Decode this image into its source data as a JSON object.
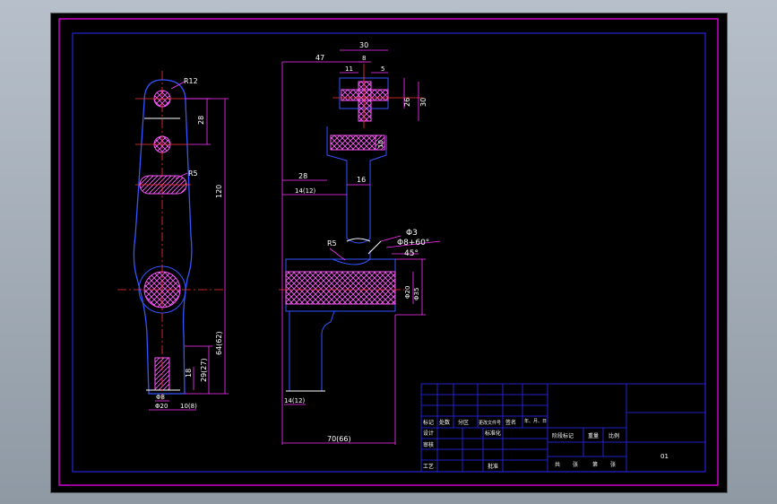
{
  "colors": {
    "background": "#000000",
    "outer_border": "#ff00ff",
    "inner_border": "#0000ff",
    "outline": "#3355ff",
    "dimension": "#ff33ff",
    "hatch": "#ff55ff",
    "center_line": "#ff3333",
    "text": "#ffffff"
  },
  "left_view": {
    "r12": "R12",
    "dim_28": "28",
    "r5": "R5",
    "dim_120": "120",
    "dim_64": "64(62)",
    "dim_29": "29(27)",
    "dim_18": "18",
    "dim_phi8": "Φ8",
    "dim_phi20": "Φ20",
    "dim_10": "10(8)"
  },
  "right_view": {
    "dim_30_top": "30",
    "dim_47": "47",
    "dim_11": "11",
    "dim_8": "8",
    "dim_5": "5",
    "dim_26": "26",
    "dim_30_side": "30",
    "dim_10": "10",
    "dim_28": "28",
    "dim_16": "16",
    "dim_14_12": "14(12)",
    "r5": "R5",
    "phi3": "Φ3",
    "phi8_60": "Φ8+60°",
    "deg45": "45°",
    "phi20": "Φ20",
    "phi35": "Φ35",
    "dim_14_12_bottom": "14(12)",
    "dim_70": "70(66)"
  },
  "title_block": {
    "row_labels": [
      "标记",
      "处数",
      "分区",
      "更改文件号",
      "签名",
      "年、月、日"
    ],
    "design": "设计",
    "standardize": "标准化",
    "review": "审核",
    "process": "工艺",
    "approve": "批准",
    "stage_mark": "阶段标记",
    "weight": "重量",
    "scale": "比例",
    "sheet_total": "共",
    "sheet": "张",
    "sheet_of": "第",
    "sheet2": "张",
    "code": "01"
  }
}
